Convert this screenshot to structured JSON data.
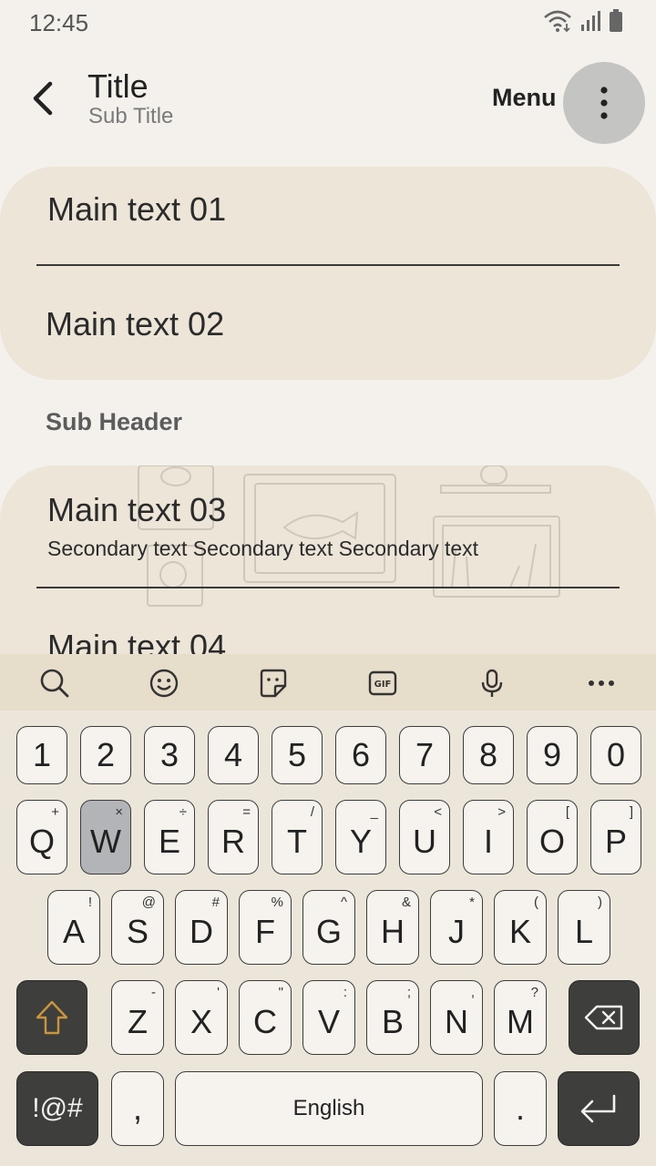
{
  "status_bar": {
    "time": "12:45"
  },
  "app_bar": {
    "title": "Title",
    "subtitle": "Sub Title",
    "menu_label": "Menu"
  },
  "list": {
    "group1": [
      {
        "main": "Main text 01"
      },
      {
        "main": "Main text 02"
      }
    ],
    "sub_header": "Sub Header",
    "group2": [
      {
        "main": "Main text 03",
        "secondary": "Secondary text Secondary text Secondary text"
      },
      {
        "main": "Main text 04"
      }
    ]
  },
  "keyboard": {
    "toolbar_icons": [
      "search-icon",
      "emoji-icon",
      "sticker-icon",
      "gif-icon",
      "microphone-icon",
      "more-icon"
    ],
    "number_row": [
      "1",
      "2",
      "3",
      "4",
      "5",
      "6",
      "7",
      "8",
      "9",
      "0"
    ],
    "row1": [
      {
        "key": "Q",
        "sym": "+"
      },
      {
        "key": "W",
        "sym": "×"
      },
      {
        "key": "E",
        "sym": "÷"
      },
      {
        "key": "R",
        "sym": "="
      },
      {
        "key": "T",
        "sym": "/"
      },
      {
        "key": "Y",
        "sym": "_"
      },
      {
        "key": "U",
        "sym": "<"
      },
      {
        "key": "I",
        "sym": ">"
      },
      {
        "key": "O",
        "sym": "["
      },
      {
        "key": "P",
        "sym": "]"
      }
    ],
    "row2": [
      {
        "key": "A",
        "sym": "!"
      },
      {
        "key": "S",
        "sym": "@"
      },
      {
        "key": "D",
        "sym": "#"
      },
      {
        "key": "F",
        "sym": "%"
      },
      {
        "key": "G",
        "sym": "^"
      },
      {
        "key": "H",
        "sym": "&"
      },
      {
        "key": "J",
        "sym": "*"
      },
      {
        "key": "K",
        "sym": "("
      },
      {
        "key": "L",
        "sym": ")"
      }
    ],
    "row3": [
      {
        "key": "Z",
        "sym": "-"
      },
      {
        "key": "X",
        "sym": "'"
      },
      {
        "key": "C",
        "sym": "\""
      },
      {
        "key": "V",
        "sym": ":"
      },
      {
        "key": "B",
        "sym": ";"
      },
      {
        "key": "N",
        "sym": ","
      },
      {
        "key": "M",
        "sym": "?"
      }
    ],
    "symbols_key": "!@#",
    "comma_key": ",",
    "space_label": "English",
    "period_key": ".",
    "pressed_key": "W"
  }
}
